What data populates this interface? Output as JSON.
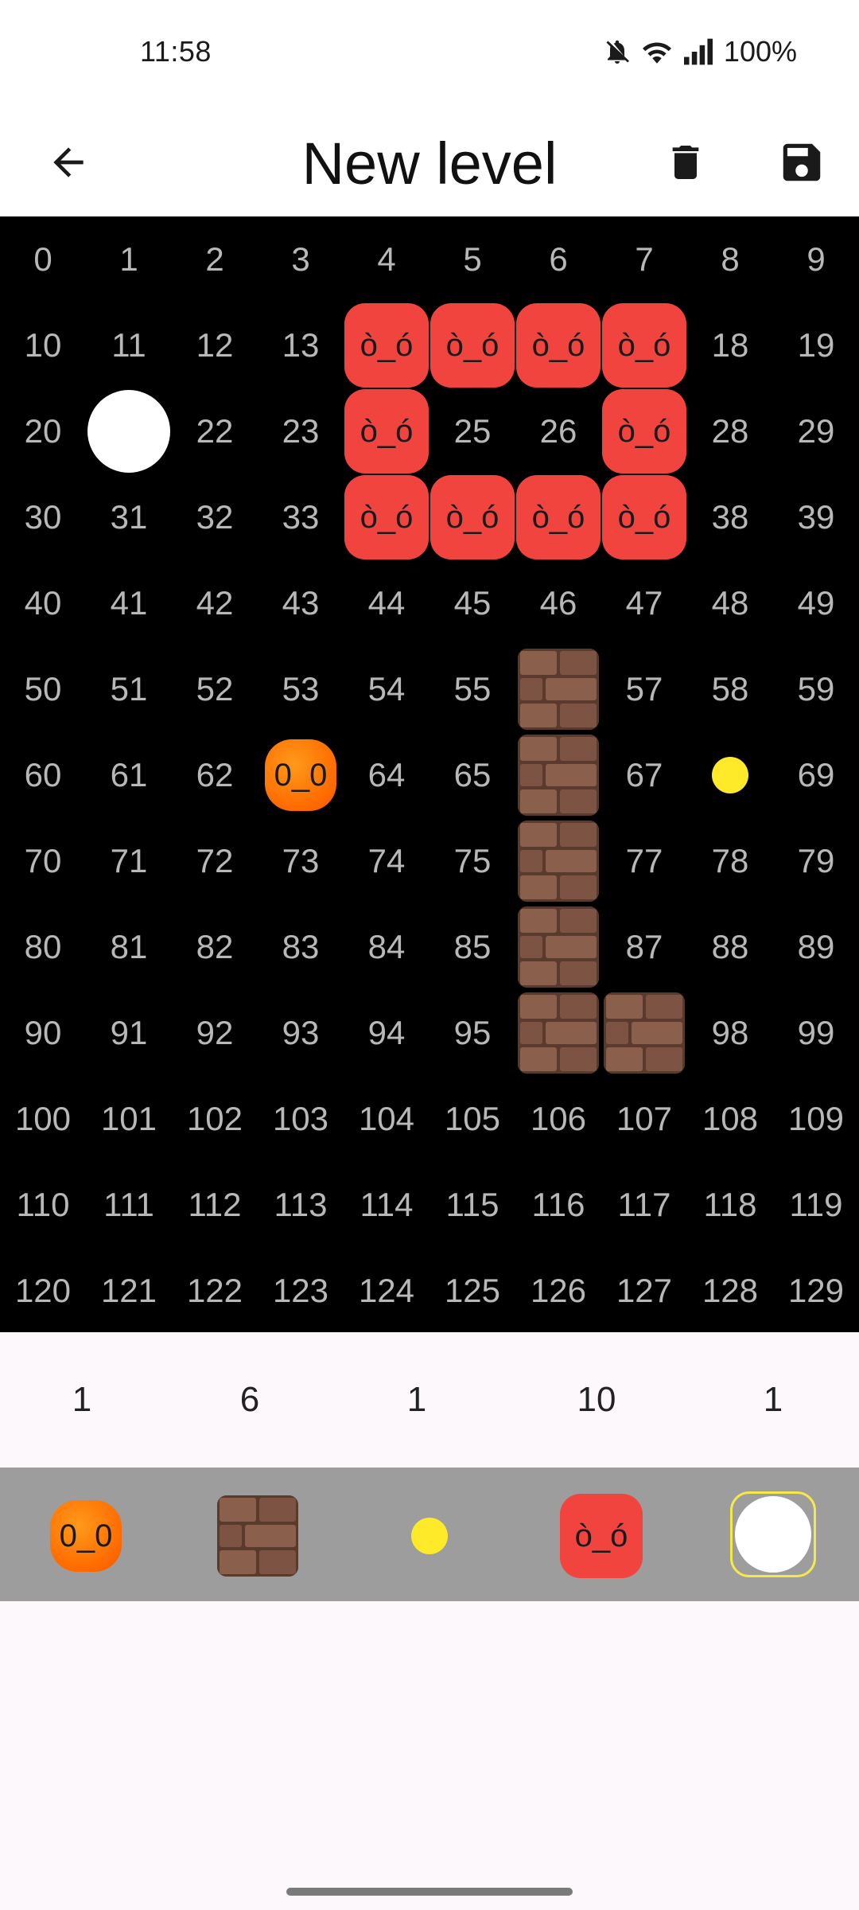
{
  "status": {
    "time": "11:58",
    "battery": "100%"
  },
  "app_bar": {
    "title": "New level",
    "back_icon": "arrow-back-icon",
    "delete_icon": "trash-icon",
    "save_icon": "save-icon"
  },
  "tile_labels": {
    "player": "0_0",
    "enemy": "ò_ó"
  },
  "grid": {
    "columns": 10,
    "rows": 13,
    "placed": {
      "14": "enemy",
      "15": "enemy",
      "16": "enemy",
      "17": "enemy",
      "21": "white",
      "24": "enemy",
      "27": "enemy",
      "34": "enemy",
      "35": "enemy",
      "36": "enemy",
      "37": "enemy",
      "56": "brick",
      "63": "player",
      "66": "brick",
      "68": "coin",
      "76": "brick",
      "86": "brick",
      "96": "brick",
      "97": "brick"
    }
  },
  "counts": [
    "1",
    "6",
    "1",
    "10",
    "1"
  ],
  "palette": {
    "items": [
      "player",
      "brick",
      "coin",
      "enemy",
      "white"
    ],
    "selected": "white"
  },
  "colors": {
    "grid_bg": "#000000",
    "enemy": "#f2443f",
    "player": "#ff6a00",
    "coin": "#ffea2a",
    "brick": "#6a4535",
    "palette_bg": "#9d9d9d",
    "selected_border": "#f5e84a"
  }
}
